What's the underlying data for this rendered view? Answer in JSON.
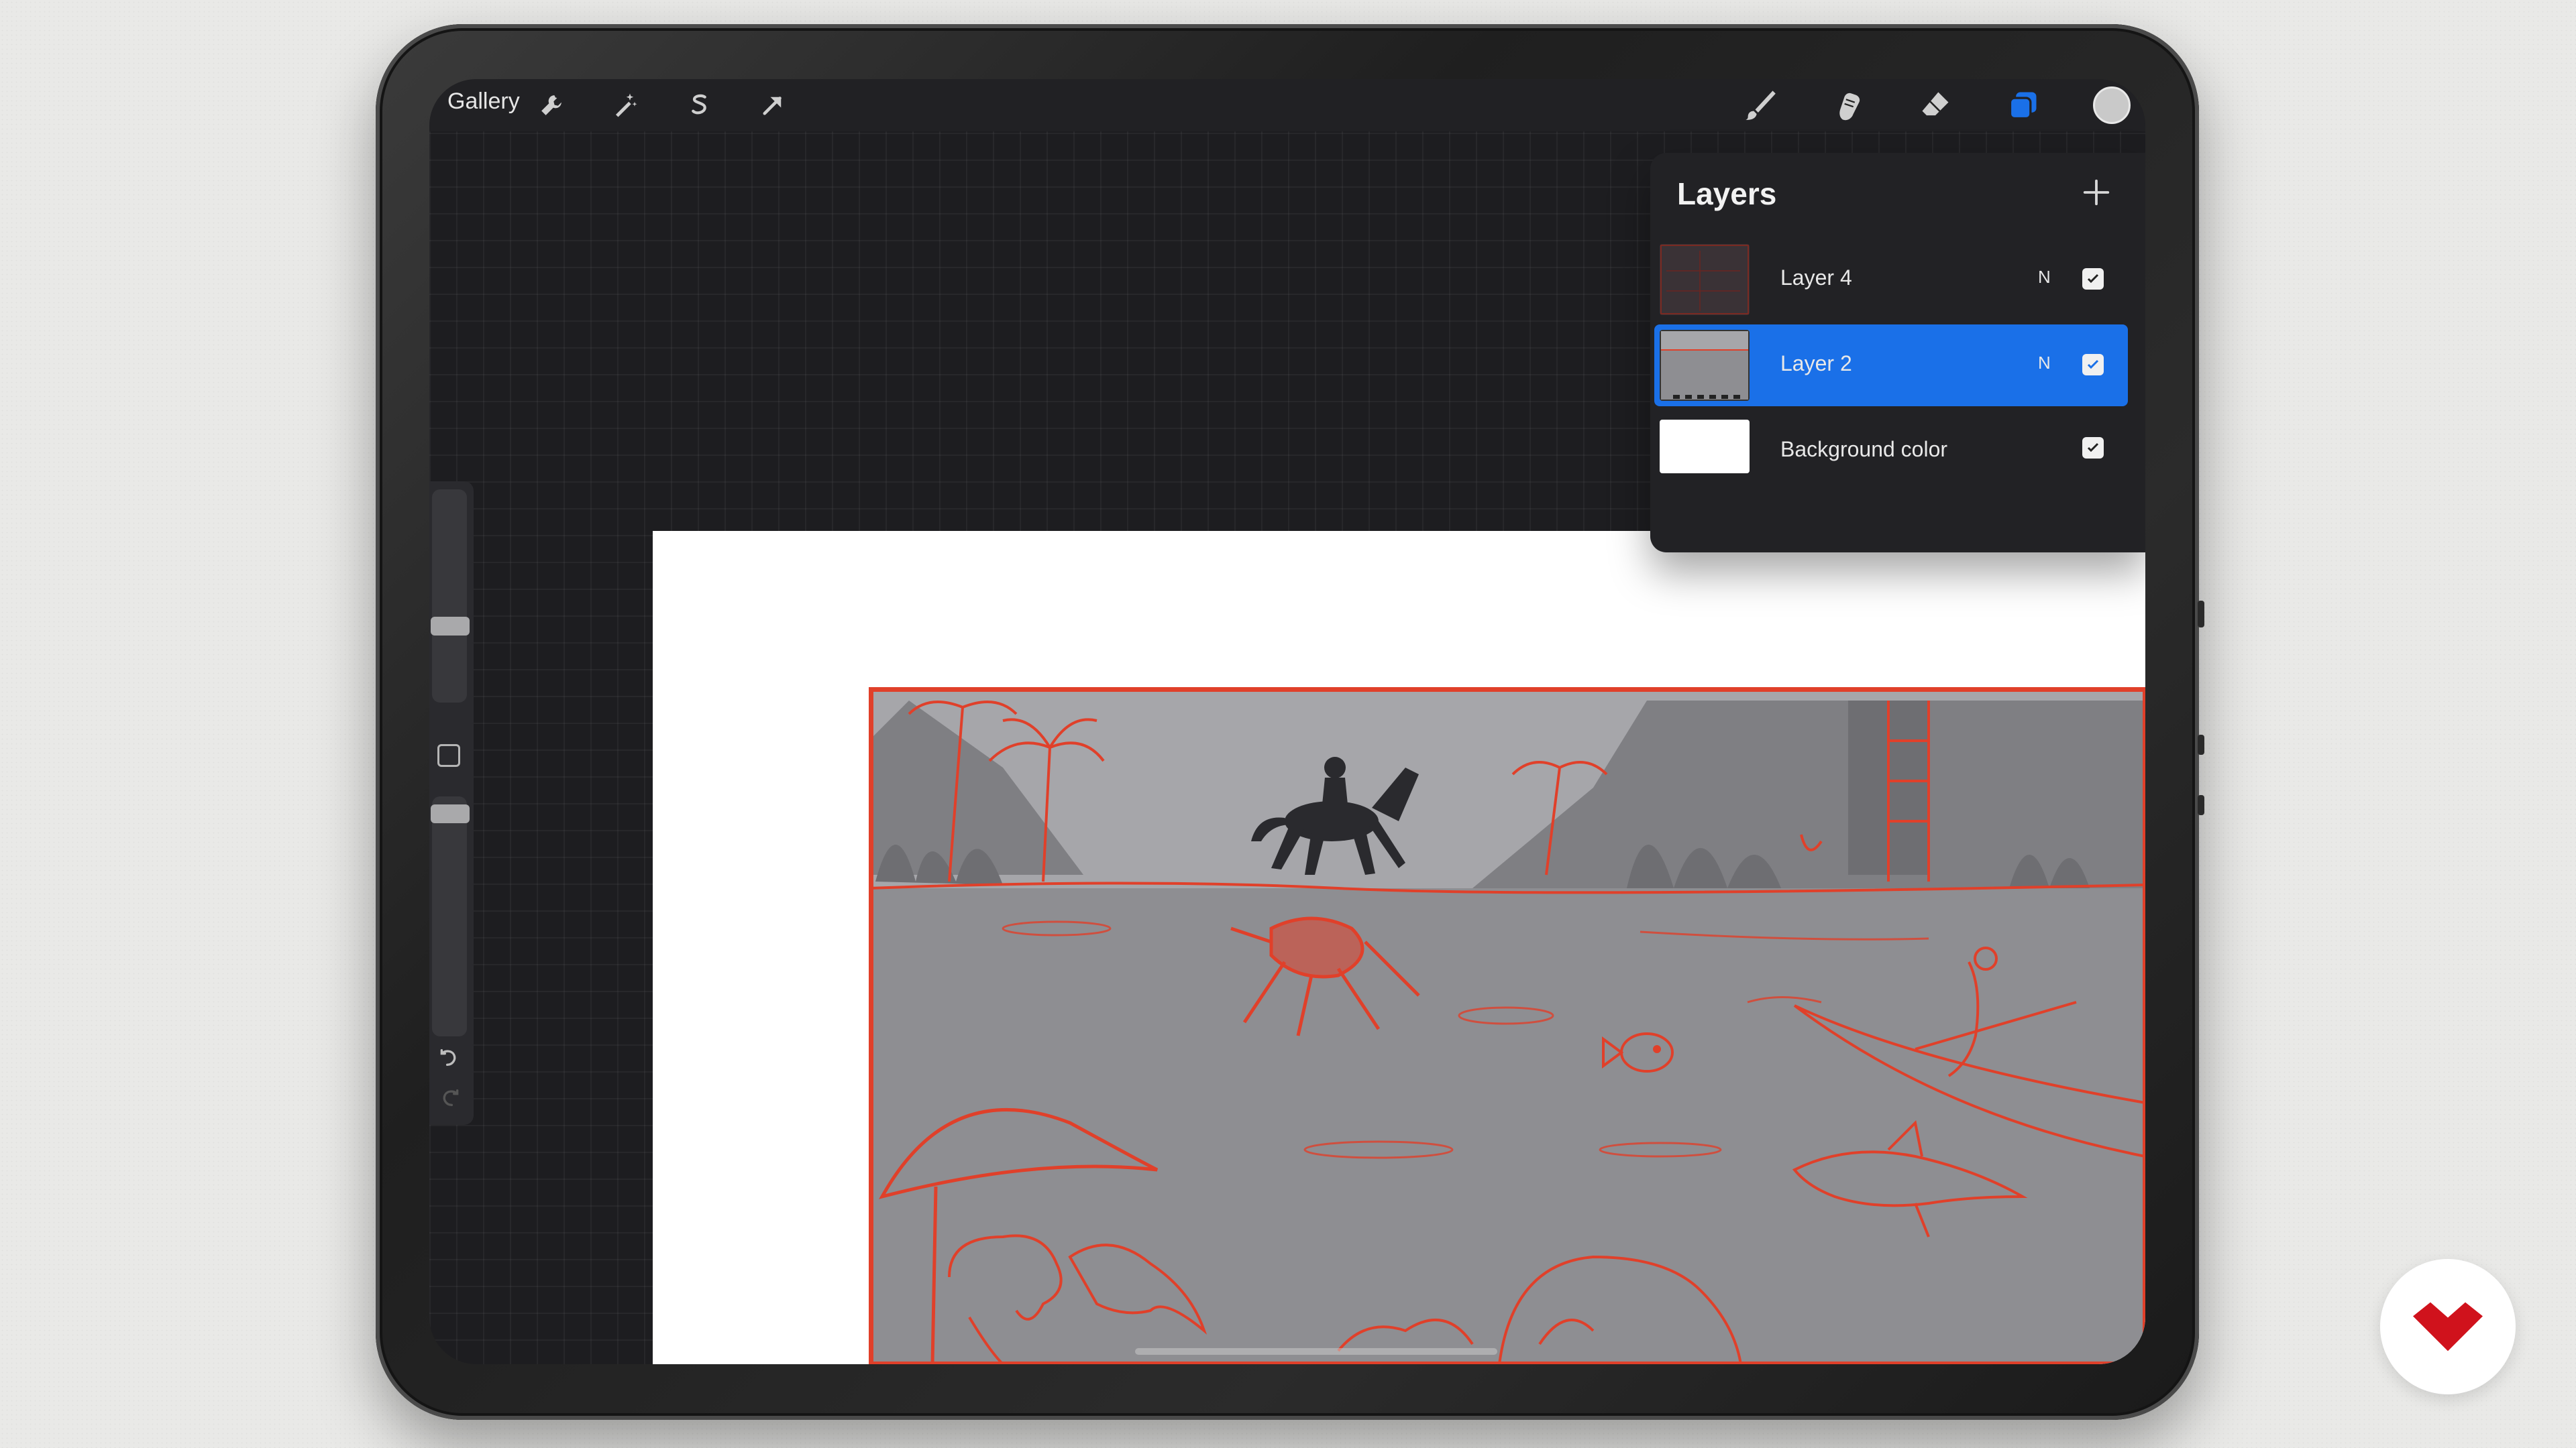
{
  "toolbar": {
    "gallery_label": "Gallery",
    "left_tools": [
      "wrench-icon",
      "magic-wand-icon",
      "selection-icon",
      "transform-arrow-icon"
    ],
    "right_tools": [
      "brush-icon",
      "smudge-icon",
      "eraser-icon",
      "layers-icon"
    ],
    "active_tool": "layers",
    "accent_color": "#1a70e8",
    "current_color": "#c9c9c9"
  },
  "sidebar": {
    "brush_size_level": 0.55,
    "opacity_level": 0.2,
    "undo_icon": "undo-icon",
    "redo_icon": "redo-icon"
  },
  "layers_panel": {
    "title": "Layers",
    "add_icon": "plus-icon",
    "layers": [
      {
        "name": "Layer 4",
        "blend": "N",
        "visible": true,
        "selected": false
      },
      {
        "name": "Layer 2",
        "blend": "N",
        "visible": true,
        "selected": true
      },
      {
        "name": "Background color",
        "blend": "",
        "visible": true,
        "selected": false
      }
    ]
  },
  "artwork": {
    "sketch_color": "#e0402a",
    "background_gray": "#8e8e92"
  },
  "branding": {
    "logo_icon": "brand-logo-icon",
    "logo_color": "#d0121c"
  }
}
